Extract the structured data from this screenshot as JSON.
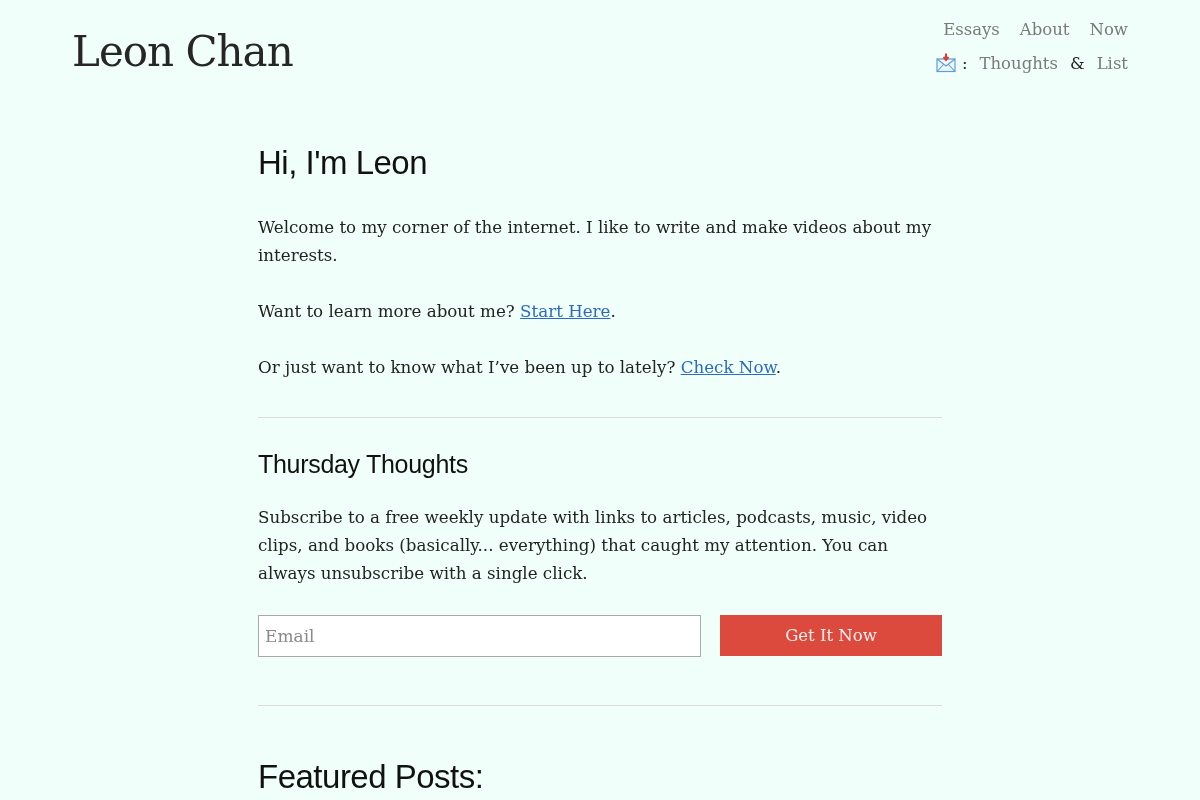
{
  "site_title": "Leon Chan",
  "nav": {
    "links": [
      {
        "label": "Essays"
      },
      {
        "label": "About"
      },
      {
        "label": "Now"
      }
    ],
    "newsletter_items": [
      {
        "kind": "text",
        "text": ":"
      },
      {
        "kind": "link",
        "text": "Thoughts"
      },
      {
        "kind": "text",
        "text": "&"
      },
      {
        "kind": "link",
        "text": "List"
      }
    ]
  },
  "intro": {
    "heading": "Hi, I'm Leon",
    "paragraphs": [
      [
        {
          "kind": "text",
          "text": "Welcome to my corner of the internet. I like to write and make videos about my interests."
        }
      ],
      [
        {
          "kind": "text",
          "text": "Want to learn more about me? "
        },
        {
          "kind": "link",
          "text": "Start Here"
        },
        {
          "kind": "text",
          "text": "."
        }
      ],
      [
        {
          "kind": "text",
          "text": "Or just want to know what I’ve been up to lately? "
        },
        {
          "kind": "link",
          "text": "Check Now"
        },
        {
          "kind": "text",
          "text": "."
        }
      ]
    ]
  },
  "newsletter": {
    "heading": "Thursday Thoughts",
    "description": "Subscribe to a free weekly update with links to articles, podcasts, music, video clips, and books (basically... everything) that caught my attention. You can always unsubscribe with a single click.",
    "email": {
      "placeholder": "Email"
    },
    "button": "Get It Now"
  },
  "featured": {
    "heading": "Featured Posts:"
  }
}
